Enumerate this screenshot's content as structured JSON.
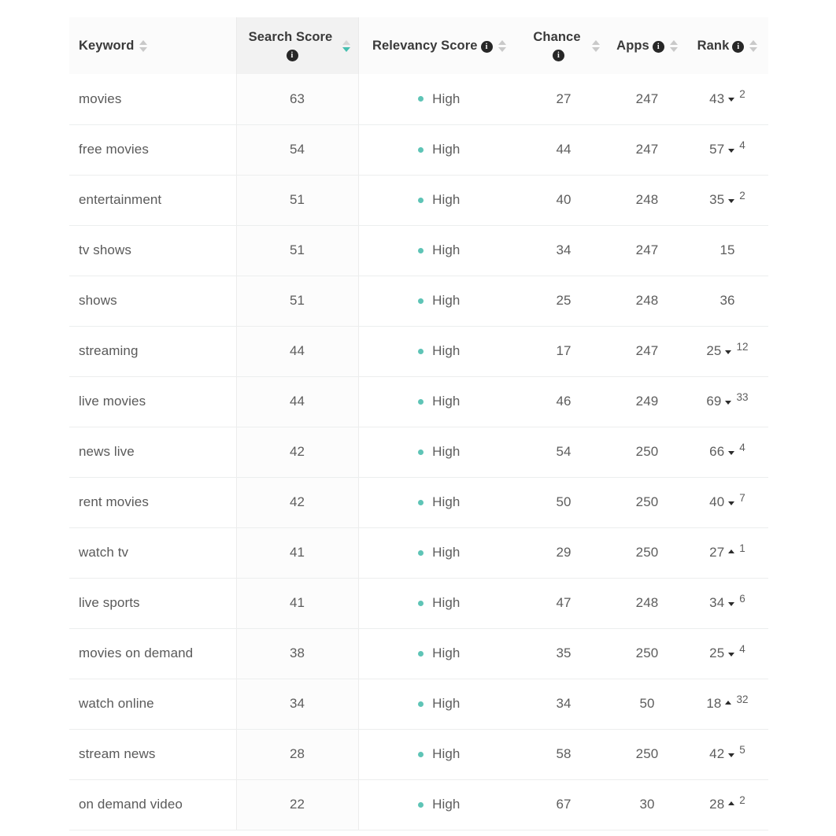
{
  "table": {
    "columns": [
      {
        "key": "keyword",
        "label": "Keyword",
        "has_info": false,
        "align": "left",
        "sorted": false,
        "sort_dir": "none"
      },
      {
        "key": "search",
        "label": "Search Score",
        "has_info": true,
        "align": "center",
        "sorted": true,
        "sort_dir": "desc"
      },
      {
        "key": "relevancy",
        "label": "Relevancy Score",
        "has_info": true,
        "align": "center",
        "sorted": false,
        "sort_dir": "none"
      },
      {
        "key": "chance",
        "label": "Chance",
        "has_info": true,
        "align": "center",
        "sorted": false,
        "sort_dir": "none"
      },
      {
        "key": "apps",
        "label": "Apps",
        "has_info": true,
        "align": "center",
        "sorted": false,
        "sort_dir": "none"
      },
      {
        "key": "rank",
        "label": "Rank",
        "has_info": true,
        "align": "center",
        "sorted": false,
        "sort_dir": "none"
      }
    ],
    "headers": {
      "keyword": "Keyword",
      "search_score": "Search Score",
      "relevancy_score": "Relevancy Score",
      "chance": "Chance",
      "apps": "Apps",
      "rank": "Rank"
    },
    "rows": [
      {
        "keyword": "movies",
        "search_score": 63,
        "relevancy": "High",
        "chance": 27,
        "apps": 247,
        "rank": 43,
        "rank_dir": "down",
        "rank_delta": 2
      },
      {
        "keyword": "free movies",
        "search_score": 54,
        "relevancy": "High",
        "chance": 44,
        "apps": 247,
        "rank": 57,
        "rank_dir": "down",
        "rank_delta": 4
      },
      {
        "keyword": "entertainment",
        "search_score": 51,
        "relevancy": "High",
        "chance": 40,
        "apps": 248,
        "rank": 35,
        "rank_dir": "down",
        "rank_delta": 2
      },
      {
        "keyword": "tv shows",
        "search_score": 51,
        "relevancy": "High",
        "chance": 34,
        "apps": 247,
        "rank": 15,
        "rank_dir": "none",
        "rank_delta": null
      },
      {
        "keyword": "shows",
        "search_score": 51,
        "relevancy": "High",
        "chance": 25,
        "apps": 248,
        "rank": 36,
        "rank_dir": "none",
        "rank_delta": null
      },
      {
        "keyword": "streaming",
        "search_score": 44,
        "relevancy": "High",
        "chance": 17,
        "apps": 247,
        "rank": 25,
        "rank_dir": "down",
        "rank_delta": 12
      },
      {
        "keyword": "live movies",
        "search_score": 44,
        "relevancy": "High",
        "chance": 46,
        "apps": 249,
        "rank": 69,
        "rank_dir": "down",
        "rank_delta": 33
      },
      {
        "keyword": "news live",
        "search_score": 42,
        "relevancy": "High",
        "chance": 54,
        "apps": 250,
        "rank": 66,
        "rank_dir": "down",
        "rank_delta": 4
      },
      {
        "keyword": "rent movies",
        "search_score": 42,
        "relevancy": "High",
        "chance": 50,
        "apps": 250,
        "rank": 40,
        "rank_dir": "down",
        "rank_delta": 7
      },
      {
        "keyword": "watch tv",
        "search_score": 41,
        "relevancy": "High",
        "chance": 29,
        "apps": 250,
        "rank": 27,
        "rank_dir": "up",
        "rank_delta": 1
      },
      {
        "keyword": "live sports",
        "search_score": 41,
        "relevancy": "High",
        "chance": 47,
        "apps": 248,
        "rank": 34,
        "rank_dir": "down",
        "rank_delta": 6
      },
      {
        "keyword": "movies on demand",
        "search_score": 38,
        "relevancy": "High",
        "chance": 35,
        "apps": 250,
        "rank": 25,
        "rank_dir": "down",
        "rank_delta": 4
      },
      {
        "keyword": "watch online",
        "search_score": 34,
        "relevancy": "High",
        "chance": 34,
        "apps": 50,
        "rank": 18,
        "rank_dir": "up",
        "rank_delta": 32
      },
      {
        "keyword": "stream news",
        "search_score": 28,
        "relevancy": "High",
        "chance": 58,
        "apps": 250,
        "rank": 42,
        "rank_dir": "down",
        "rank_delta": 5
      },
      {
        "keyword": "on demand video",
        "search_score": 22,
        "relevancy": "High",
        "chance": 67,
        "apps": 30,
        "rank": 28,
        "rank_dir": "up",
        "rank_delta": 2
      }
    ]
  },
  "icons": {
    "info": "info-icon",
    "sort": "sort-icon",
    "rank_up": "arrow-up-icon",
    "rank_down": "arrow-down-icon",
    "relevancy_dot": "status-dot-icon"
  },
  "colors": {
    "relevancy_dot": "#5ec4b6",
    "sort_active": "#46bfb0",
    "sort_inactive": "#c9c9c9",
    "header_bg": "#fbfbfb",
    "header_sorted_bg": "#f2f2f2",
    "score_column_bg": "#fcfcfc",
    "text": "#5d5d5d",
    "row_border": "#eceeee"
  }
}
